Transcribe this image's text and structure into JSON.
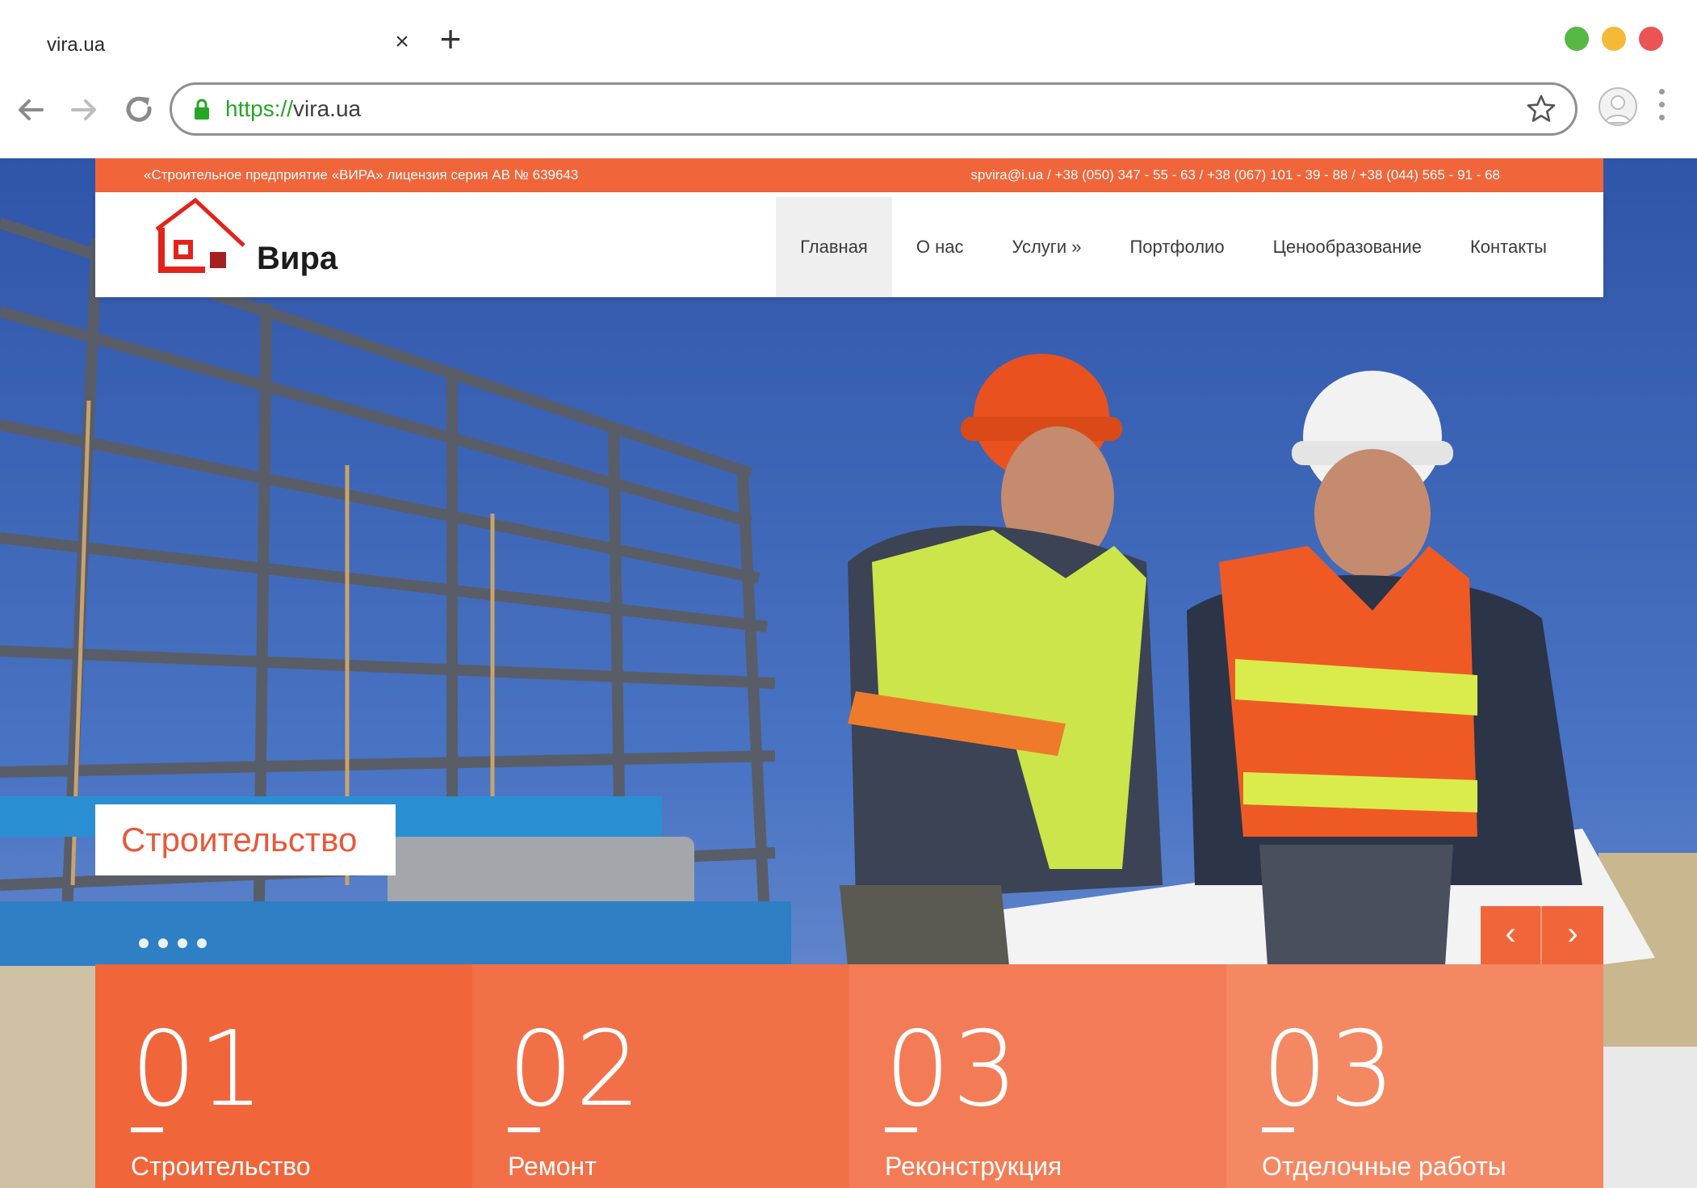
{
  "browser": {
    "tab_title": "vira.ua",
    "tab_close": "×",
    "new_tab": "+",
    "url_scheme": "https://",
    "url_host": "vira.ua",
    "window_buttons": [
      {
        "name": "maximize",
        "color": "#57b846"
      },
      {
        "name": "minimize",
        "color": "#f5b939"
      },
      {
        "name": "close",
        "color": "#ec5454"
      }
    ]
  },
  "site": {
    "topbar": {
      "license": "«Строительное предприятие «ВИРА» лицензия серия АВ № 639643",
      "contacts": "spvira@i.ua / +38 (050) 347 - 55 - 63 / +38 (067) 101 - 39 - 88 / +38 (044) 565 - 91 - 68"
    },
    "logo_text": "Вира",
    "nav": [
      {
        "label": "Главная",
        "active": true
      },
      {
        "label": "О нас",
        "active": false
      },
      {
        "label": "Услуги »",
        "active": false
      },
      {
        "label": "Портфолио",
        "active": false
      },
      {
        "label": "Ценообразование",
        "active": false
      },
      {
        "label": "Контакты",
        "active": false
      }
    ],
    "slide_caption": "Строительство",
    "slider_prev": "‹",
    "slider_next": "›",
    "tiles": [
      {
        "number": "01",
        "label": "Строительство",
        "color": "#f0653a"
      },
      {
        "number": "02",
        "label": "Ремонт",
        "color": "#f27048"
      },
      {
        "number": "03",
        "label": "Реконструкция",
        "color": "#f37c56"
      },
      {
        "number": "03",
        "label": "Отделочные работы",
        "color": "#f48863"
      }
    ],
    "accent_color": "#f0653a"
  }
}
